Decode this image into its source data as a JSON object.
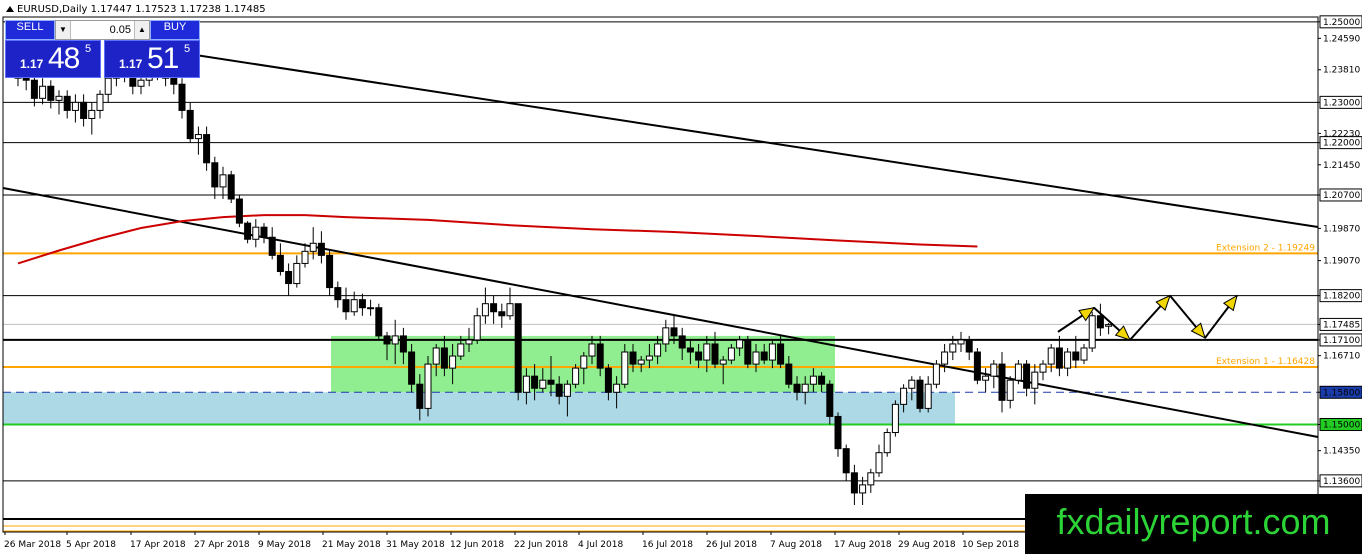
{
  "symbol": {
    "title": "EURUSD,Daily  1.17447 1.17523 1.17238 1.17485"
  },
  "trade_panel": {
    "sell_label": "SELL",
    "buy_label": "BUY",
    "lot_value": "0.05",
    "sell_quote": {
      "prefix": "1.17",
      "big": "48",
      "small": "5"
    },
    "buy_quote": {
      "prefix": "1.17",
      "big": "51",
      "small": "5"
    }
  },
  "watermark": "fxdailyreport.com",
  "colors": {
    "bull": "#ffffff",
    "bear": "#000000",
    "ma": "#cc0000",
    "fib": "#ffa500",
    "green_zone": "#90ee90",
    "blue_zone": "#add8e6",
    "current_price_bg": "#ffffff"
  },
  "chart_data": {
    "type": "candlestick",
    "symbol": "EURUSD",
    "timeframe": "Daily",
    "ylim": [
      1.1233,
      1.2512
    ],
    "price_labels": [
      "1.25000",
      "1.24590",
      "1.23810",
      "1.23000",
      "1.22230",
      "1.22000",
      "1.21450",
      "1.20700",
      "1.19870",
      "1.19249",
      "1.19070",
      "1.18200",
      "1.17485",
      "1.17100",
      "1.16710",
      "1.16428",
      "1.15800",
      "1.15000",
      "1.14350",
      "1.13600"
    ],
    "date_labels": [
      "26 Mar 2018",
      "5 Apr 2018",
      "17 Apr 2018",
      "27 Apr 2018",
      "9 May 2018",
      "21 May 2018",
      "31 May 2018",
      "12 Jun 2018",
      "22 Jun 2018",
      "4 Jul 2018",
      "16 Jul 2018",
      "26 Jul 2018",
      "7 Aug 2018",
      "17 Aug 2018",
      "29 Aug 2018",
      "10 Sep 2018"
    ],
    "horizontal_levels": [
      {
        "price": 1.25,
        "label": "1.25000",
        "style": "solid-black"
      },
      {
        "price": 1.23,
        "label": "1.23000",
        "style": "solid-black"
      },
      {
        "price": 1.22,
        "label": "1.22000",
        "style": "solid-black"
      },
      {
        "price": 1.207,
        "label": "1.20700",
        "style": "solid-black"
      },
      {
        "price": 1.182,
        "label": "1.18200",
        "style": "solid-black"
      },
      {
        "price": 1.171,
        "label": "1.17100",
        "style": "thick-black"
      },
      {
        "price": 1.158,
        "label": "1.15800",
        "style": "dashed-blue"
      },
      {
        "price": 1.15,
        "label": "1.15000",
        "style": "solid-green"
      },
      {
        "price": 1.136,
        "label": "1.13600",
        "style": "solid-black"
      }
    ],
    "extension_levels": [
      {
        "price": 1.19249,
        "label": "Extension 2 - 1.19249"
      },
      {
        "price": 1.16428,
        "label": "Extension 1 - 1.16428"
      }
    ],
    "current_price": 1.17485,
    "moving_average": [
      [
        0,
        1.19
      ],
      [
        5,
        1.1932
      ],
      [
        10,
        1.1962
      ],
      [
        15,
        1.1988
      ],
      [
        20,
        1.2005
      ],
      [
        25,
        1.2015
      ],
      [
        30,
        1.202
      ],
      [
        35,
        1.202
      ],
      [
        40,
        1.2015
      ],
      [
        50,
        1.2008
      ],
      [
        60,
        1.1995
      ],
      [
        70,
        1.1985
      ],
      [
        80,
        1.1978
      ],
      [
        90,
        1.1968
      ],
      [
        100,
        1.1957
      ],
      [
        110,
        1.1947
      ],
      [
        117,
        1.1942
      ]
    ],
    "candles": [
      [
        1.236,
        1.241,
        1.234,
        1.2405
      ],
      [
        1.2405,
        1.243,
        1.233,
        1.2355
      ],
      [
        1.2355,
        1.238,
        1.229,
        1.231
      ],
      [
        1.231,
        1.236,
        1.2295,
        1.234
      ],
      [
        1.234,
        1.2355,
        1.2285,
        1.2305
      ],
      [
        1.2305,
        1.233,
        1.227,
        1.2315
      ],
      [
        1.2315,
        1.233,
        1.226,
        1.228
      ],
      [
        1.228,
        1.232,
        1.225,
        1.23
      ],
      [
        1.23,
        1.232,
        1.224,
        1.226
      ],
      [
        1.226,
        1.23,
        1.222,
        1.228
      ],
      [
        1.228,
        1.233,
        1.226,
        1.232
      ],
      [
        1.232,
        1.237,
        1.23,
        1.236
      ],
      [
        1.236,
        1.24,
        1.234,
        1.2385
      ],
      [
        1.2385,
        1.2405,
        1.235,
        1.237
      ],
      [
        1.237,
        1.239,
        1.232,
        1.234
      ],
      [
        1.234,
        1.2375,
        1.232,
        1.2355
      ],
      [
        1.2355,
        1.241,
        1.234,
        1.2395
      ],
      [
        1.2395,
        1.242,
        1.2355,
        1.237
      ],
      [
        1.237,
        1.2405,
        1.234,
        1.236
      ],
      [
        1.236,
        1.239,
        1.232,
        1.2345
      ],
      [
        1.2345,
        1.236,
        1.226,
        1.228
      ],
      [
        1.228,
        1.23,
        1.22,
        1.221
      ],
      [
        1.221,
        1.224,
        1.217,
        1.222
      ],
      [
        1.222,
        1.224,
        1.213,
        1.215
      ],
      [
        1.215,
        1.2165,
        1.206,
        1.209
      ],
      [
        1.209,
        1.214,
        1.206,
        1.212
      ],
      [
        1.212,
        1.213,
        1.205,
        1.206
      ],
      [
        1.206,
        1.207,
        1.199,
        1.2
      ],
      [
        1.2,
        1.2005,
        1.195,
        1.196
      ],
      [
        1.196,
        1.201,
        1.194,
        1.199
      ],
      [
        1.199,
        1.2,
        1.195,
        1.1965
      ],
      [
        1.1965,
        1.199,
        1.191,
        1.192
      ],
      [
        1.192,
        1.195,
        1.187,
        1.188
      ],
      [
        1.188,
        1.19,
        1.182,
        1.185
      ],
      [
        1.185,
        1.192,
        1.184,
        1.19
      ],
      [
        1.19,
        1.195,
        1.189,
        1.193
      ],
      [
        1.193,
        1.199,
        1.191,
        1.195
      ],
      [
        1.195,
        1.198,
        1.19,
        1.192
      ],
      [
        1.192,
        1.1935,
        1.182,
        1.184
      ],
      [
        1.184,
        1.1855,
        1.179,
        1.181
      ],
      [
        1.181,
        1.184,
        1.176,
        1.178
      ],
      [
        1.178,
        1.183,
        1.177,
        1.181
      ],
      [
        1.181,
        1.1825,
        1.177,
        1.179
      ],
      [
        1.179,
        1.181,
        1.177,
        1.179
      ],
      [
        1.179,
        1.18,
        1.171,
        1.172
      ],
      [
        1.172,
        1.173,
        1.166,
        1.17
      ],
      [
        1.17,
        1.176,
        1.165,
        1.172
      ],
      [
        1.172,
        1.174,
        1.165,
        1.168
      ],
      [
        1.168,
        1.17,
        1.158,
        1.16
      ],
      [
        1.16,
        1.1625,
        1.151,
        1.154
      ],
      [
        1.154,
        1.167,
        1.152,
        1.165
      ],
      [
        1.165,
        1.17,
        1.162,
        1.169
      ],
      [
        1.169,
        1.172,
        1.162,
        1.164
      ],
      [
        1.164,
        1.17,
        1.16,
        1.167
      ],
      [
        1.167,
        1.172,
        1.166,
        1.17
      ],
      [
        1.17,
        1.174,
        1.168,
        1.171
      ],
      [
        1.171,
        1.179,
        1.17,
        1.177
      ],
      [
        1.177,
        1.184,
        1.175,
        1.18
      ],
      [
        1.18,
        1.182,
        1.175,
        1.178
      ],
      [
        1.178,
        1.18,
        1.174,
        1.177
      ],
      [
        1.177,
        1.184,
        1.176,
        1.18
      ],
      [
        1.18,
        1.18,
        1.156,
        1.158
      ],
      [
        1.158,
        1.164,
        1.155,
        1.162
      ],
      [
        1.162,
        1.165,
        1.156,
        1.159
      ],
      [
        1.159,
        1.164,
        1.158,
        1.161
      ],
      [
        1.161,
        1.167,
        1.157,
        1.16
      ],
      [
        1.16,
        1.162,
        1.155,
        1.157
      ],
      [
        1.157,
        1.161,
        1.152,
        1.16
      ],
      [
        1.16,
        1.165,
        1.159,
        1.164
      ],
      [
        1.164,
        1.168,
        1.16,
        1.167
      ],
      [
        1.167,
        1.172,
        1.165,
        1.17
      ],
      [
        1.17,
        1.172,
        1.162,
        1.164
      ],
      [
        1.164,
        1.165,
        1.156,
        1.158
      ],
      [
        1.158,
        1.162,
        1.154,
        1.16
      ],
      [
        1.16,
        1.17,
        1.159,
        1.168
      ],
      [
        1.168,
        1.17,
        1.163,
        1.165
      ],
      [
        1.165,
        1.167,
        1.163,
        1.166
      ],
      [
        1.166,
        1.17,
        1.164,
        1.167
      ],
      [
        1.167,
        1.172,
        1.165,
        1.17
      ],
      [
        1.17,
        1.176,
        1.168,
        1.174
      ],
      [
        1.174,
        1.177,
        1.17,
        1.172
      ],
      [
        1.172,
        1.174,
        1.166,
        1.169
      ],
      [
        1.169,
        1.171,
        1.165,
        1.168
      ],
      [
        1.168,
        1.17,
        1.164,
        1.166
      ],
      [
        1.166,
        1.172,
        1.163,
        1.17
      ],
      [
        1.17,
        1.173,
        1.164,
        1.165
      ],
      [
        1.165,
        1.167,
        1.16,
        1.166
      ],
      [
        1.166,
        1.17,
        1.165,
        1.169
      ],
      [
        1.169,
        1.172,
        1.167,
        1.171
      ],
      [
        1.171,
        1.172,
        1.164,
        1.165
      ],
      [
        1.165,
        1.17,
        1.163,
        1.168
      ],
      [
        1.168,
        1.17,
        1.165,
        1.166
      ],
      [
        1.166,
        1.171,
        1.164,
        1.17
      ],
      [
        1.17,
        1.172,
        1.164,
        1.165
      ],
      [
        1.165,
        1.167,
        1.159,
        1.16
      ],
      [
        1.16,
        1.162,
        1.156,
        1.158
      ],
      [
        1.158,
        1.162,
        1.155,
        1.16
      ],
      [
        1.16,
        1.164,
        1.158,
        1.162
      ],
      [
        1.162,
        1.163,
        1.158,
        1.16
      ],
      [
        1.16,
        1.161,
        1.15,
        1.152
      ],
      [
        1.152,
        1.153,
        1.142,
        1.144
      ],
      [
        1.144,
        1.145,
        1.136,
        1.138
      ],
      [
        1.138,
        1.14,
        1.13,
        1.133
      ],
      [
        1.133,
        1.137,
        1.13,
        1.135
      ],
      [
        1.135,
        1.139,
        1.133,
        1.138
      ],
      [
        1.138,
        1.145,
        1.137,
        1.143
      ],
      [
        1.143,
        1.149,
        1.142,
        1.148
      ],
      [
        1.148,
        1.156,
        1.147,
        1.155
      ],
      [
        1.155,
        1.16,
        1.153,
        1.159
      ],
      [
        1.159,
        1.162,
        1.156,
        1.161
      ],
      [
        1.161,
        1.162,
        1.153,
        1.154
      ],
      [
        1.154,
        1.162,
        1.153,
        1.16
      ],
      [
        1.16,
        1.166,
        1.159,
        1.165
      ],
      [
        1.165,
        1.17,
        1.163,
        1.168
      ],
      [
        1.168,
        1.172,
        1.166,
        1.17
      ],
      [
        1.17,
        1.173,
        1.168,
        1.171
      ],
      [
        1.171,
        1.172,
        1.166,
        1.168
      ],
      [
        1.168,
        1.169,
        1.16,
        1.161
      ],
      [
        1.161,
        1.164,
        1.158,
        1.162
      ],
      [
        1.162,
        1.166,
        1.159,
        1.165
      ],
      [
        1.165,
        1.168,
        1.153,
        1.156
      ],
      [
        1.156,
        1.162,
        1.154,
        1.161
      ],
      [
        1.161,
        1.166,
        1.16,
        1.165
      ],
      [
        1.165,
        1.166,
        1.157,
        1.159
      ],
      [
        1.159,
        1.165,
        1.155,
        1.163
      ],
      [
        1.163,
        1.166,
        1.161,
        1.165
      ],
      [
        1.165,
        1.17,
        1.163,
        1.169
      ],
      [
        1.169,
        1.172,
        1.162,
        1.164
      ],
      [
        1.164,
        1.169,
        1.162,
        1.168
      ],
      [
        1.168,
        1.172,
        1.164,
        1.166
      ],
      [
        1.166,
        1.17,
        1.165,
        1.169
      ],
      [
        1.169,
        1.178,
        1.168,
        1.177
      ],
      [
        1.177,
        1.18,
        1.172,
        1.174
      ],
      [
        1.1744,
        1.1752,
        1.1724,
        1.1748
      ]
    ],
    "projection_path": [
      [
        1.173,
        1.179
      ],
      [
        1.179,
        1.171
      ],
      [
        1.171,
        1.182
      ],
      [
        1.182,
        1.1715
      ],
      [
        1.1715,
        1.182
      ]
    ]
  }
}
